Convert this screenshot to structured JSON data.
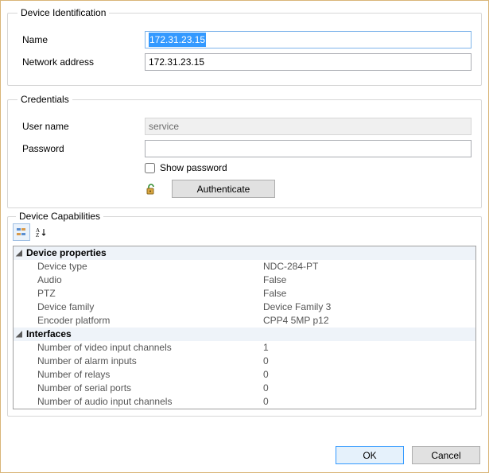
{
  "identification": {
    "legend": "Device Identification",
    "name_label": "Name",
    "name_value": "172.31.23.15",
    "address_label": "Network address",
    "address_value": "172.31.23.15"
  },
  "credentials": {
    "legend": "Credentials",
    "user_label": "User name",
    "user_value": "service",
    "password_label": "Password",
    "password_value": "",
    "show_password_label": "Show password",
    "authenticate_label": "Authenticate"
  },
  "capabilities": {
    "legend": "Device Capabilities",
    "groups": [
      {
        "title": "Device properties",
        "rows": [
          {
            "label": "Device type",
            "value": "NDC-284-PT"
          },
          {
            "label": "Audio",
            "value": "False"
          },
          {
            "label": "PTZ",
            "value": "False"
          },
          {
            "label": "Device family",
            "value": "Device Family 3"
          },
          {
            "label": "Encoder platform",
            "value": "CPP4 5MP p12"
          }
        ]
      },
      {
        "title": "Interfaces",
        "rows": [
          {
            "label": "Number of video input channels",
            "value": "1"
          },
          {
            "label": "Number of alarm inputs",
            "value": "0"
          },
          {
            "label": "Number of relays",
            "value": "0"
          },
          {
            "label": "Number of serial ports",
            "value": "0"
          },
          {
            "label": "Number of audio input channels",
            "value": "0"
          }
        ]
      }
    ]
  },
  "footer": {
    "ok": "OK",
    "cancel": "Cancel"
  }
}
